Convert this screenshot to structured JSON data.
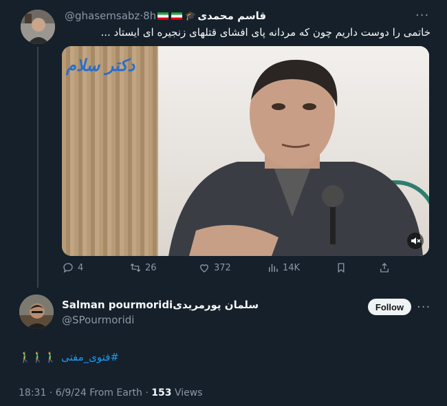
{
  "tweet": {
    "author_name": "قاسم محمدی",
    "handle": "@ghasemsabz",
    "time": "8h",
    "separator": "·",
    "text": "خاتمی را دوست داریم چون که مردانه پای افشای قتلهای زنجیره ای ایستاد ...",
    "media_watermark": "دکتر سلام",
    "actions": {
      "replies": "4",
      "retweets": "26",
      "likes": "372",
      "views": "14K"
    }
  },
  "reply": {
    "author_name": "Salman pourmoridiسلمان پورمریدی",
    "handle": "@SPourmoridi",
    "follow_label": "Follow",
    "hashtag": "#فتوی_مفتی",
    "emojis": "🚶‍♂️🚶‍♂️🚶‍♂️",
    "timestamp": "18:31 · 6/9/24 From Earth ·",
    "views_count": "153",
    "views_label": "Views"
  },
  "icons": [
    "reply-icon",
    "retweet-icon",
    "like-icon",
    "views-icon",
    "bookmark-icon",
    "share-icon",
    "more-icon",
    "mute-icon",
    "flag-icon",
    "graduation-cap-icon"
  ],
  "colors": {
    "background": "#15202b",
    "accent": "#1d9bf0",
    "muted": "#8b98a5",
    "text": "#f7f9f9"
  }
}
